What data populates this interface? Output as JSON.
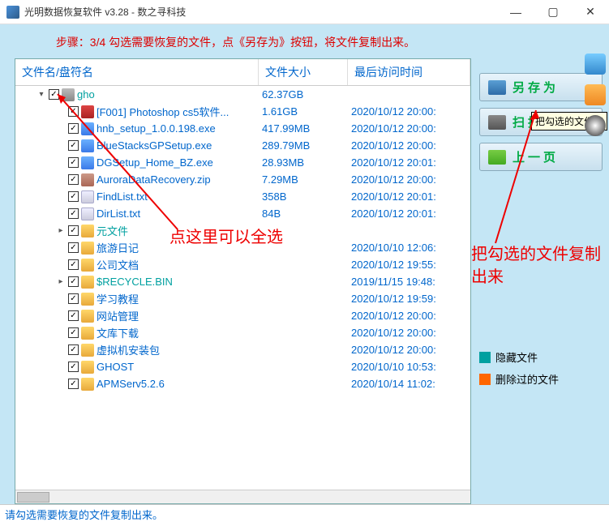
{
  "window": {
    "title": "光明数据恢复软件 v3.28 - 数之寻科技"
  },
  "step_banner": "步骤：3/4 勾选需要恢复的文件，点《另存为》按钮，将文件复制出来。",
  "columns": {
    "name": "文件名/盘符名",
    "size": "文件大小",
    "date": "最后访问时间"
  },
  "rows": [
    {
      "indent": 1,
      "exp": "▾",
      "chk": true,
      "icon": "drive",
      "name": "gho",
      "teal": true,
      "size": "62.37GB",
      "date": ""
    },
    {
      "indent": 2,
      "exp": "",
      "chk": true,
      "icon": "ps",
      "name": "[F001] Photoshop cs5软件...",
      "size": "1.61GB",
      "date": "2020/10/12 20:00:"
    },
    {
      "indent": 2,
      "exp": "",
      "chk": true,
      "icon": "exe",
      "name": "hnb_setup_1.0.0.198.exe",
      "size": "417.99MB",
      "date": "2020/10/12 20:00:"
    },
    {
      "indent": 2,
      "exp": "",
      "chk": true,
      "icon": "exe",
      "name": "BlueStacksGPSetup.exe",
      "size": "289.79MB",
      "date": "2020/10/12 20:00:"
    },
    {
      "indent": 2,
      "exp": "",
      "chk": true,
      "icon": "exe",
      "name": "DGSetup_Home_BZ.exe",
      "size": "28.93MB",
      "date": "2020/10/12 20:01:"
    },
    {
      "indent": 2,
      "exp": "",
      "chk": true,
      "icon": "zip",
      "name": "AuroraDataRecovery.zip",
      "size": "7.29MB",
      "date": "2020/10/12 20:00:"
    },
    {
      "indent": 2,
      "exp": "",
      "chk": true,
      "icon": "txt",
      "name": "FindList.txt",
      "size": "358B",
      "date": "2020/10/12 20:01:"
    },
    {
      "indent": 2,
      "exp": "",
      "chk": true,
      "icon": "txt",
      "name": "DirList.txt",
      "size": "84B",
      "date": "2020/10/12 20:01:"
    },
    {
      "indent": 2,
      "exp": "▸",
      "chk": true,
      "icon": "folder",
      "name": "元文件",
      "teal": true,
      "size": "",
      "date": ""
    },
    {
      "indent": 2,
      "exp": "",
      "chk": true,
      "icon": "folder",
      "name": "旅游日记",
      "size": "",
      "date": "2020/10/10 12:06:"
    },
    {
      "indent": 2,
      "exp": "",
      "chk": true,
      "icon": "folder",
      "name": "公司文档",
      "size": "",
      "date": "2020/10/12 19:55:"
    },
    {
      "indent": 2,
      "exp": "▸",
      "chk": true,
      "icon": "folder",
      "name": "$RECYCLE.BIN",
      "teal": true,
      "size": "",
      "date": "2019/11/15 19:48:"
    },
    {
      "indent": 2,
      "exp": "",
      "chk": true,
      "icon": "folder",
      "name": "学习教程",
      "size": "",
      "date": "2020/10/12 19:59:"
    },
    {
      "indent": 2,
      "exp": "",
      "chk": true,
      "icon": "folder",
      "name": "网站管理",
      "size": "",
      "date": "2020/10/12 20:00:"
    },
    {
      "indent": 2,
      "exp": "",
      "chk": true,
      "icon": "folder",
      "name": "文库下载",
      "size": "",
      "date": "2020/10/12 20:00:"
    },
    {
      "indent": 2,
      "exp": "",
      "chk": true,
      "icon": "folder",
      "name": "虚拟机安装包",
      "size": "",
      "date": "2020/10/12 20:00:"
    },
    {
      "indent": 2,
      "exp": "",
      "chk": true,
      "icon": "folder",
      "name": "GHOST",
      "size": "",
      "date": "2020/10/10 10:53:"
    },
    {
      "indent": 2,
      "exp": "",
      "chk": true,
      "icon": "folder",
      "name": "APMServ5.2.6",
      "size": "",
      "date": "2020/10/14 11:02:"
    }
  ],
  "side_buttons": {
    "save_as": "另存为",
    "scan_log": "扫描记录",
    "prev_page": "上一页"
  },
  "tooltip": "把勾选的文件复",
  "annotations": {
    "select_all": "点这里可以全选",
    "copy_out": "把勾选的文件复制出来"
  },
  "legend": {
    "hidden": "隐藏文件",
    "deleted": "删除过的文件"
  },
  "statusbar": "请勾选需要恢复的文件复制出来。"
}
